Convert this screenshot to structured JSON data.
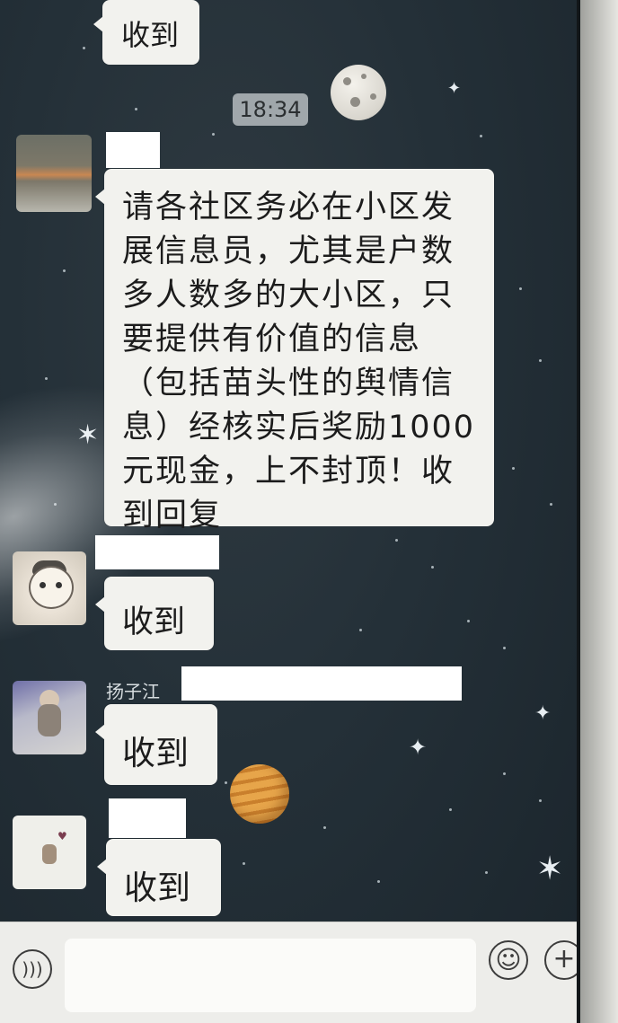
{
  "chat": {
    "time_stamp": "18:34",
    "messages": [
      {
        "text": "收到"
      },
      {
        "text": "请各社区务必在小区发展信息员，尤其是户数多人数多的大小区，只要提供有价值的信息（包括苗头性的舆情信息）经核实后奖励1000元现金，上不封顶！收到回复"
      },
      {
        "text": "收到"
      },
      {
        "sender": "扬子江",
        "text": "收到"
      },
      {
        "text": "收到"
      }
    ]
  },
  "input_bar": {
    "voice_icon": "voice-icon",
    "emoji_icon": "emoji-icon",
    "plus_icon": "plus-icon"
  }
}
